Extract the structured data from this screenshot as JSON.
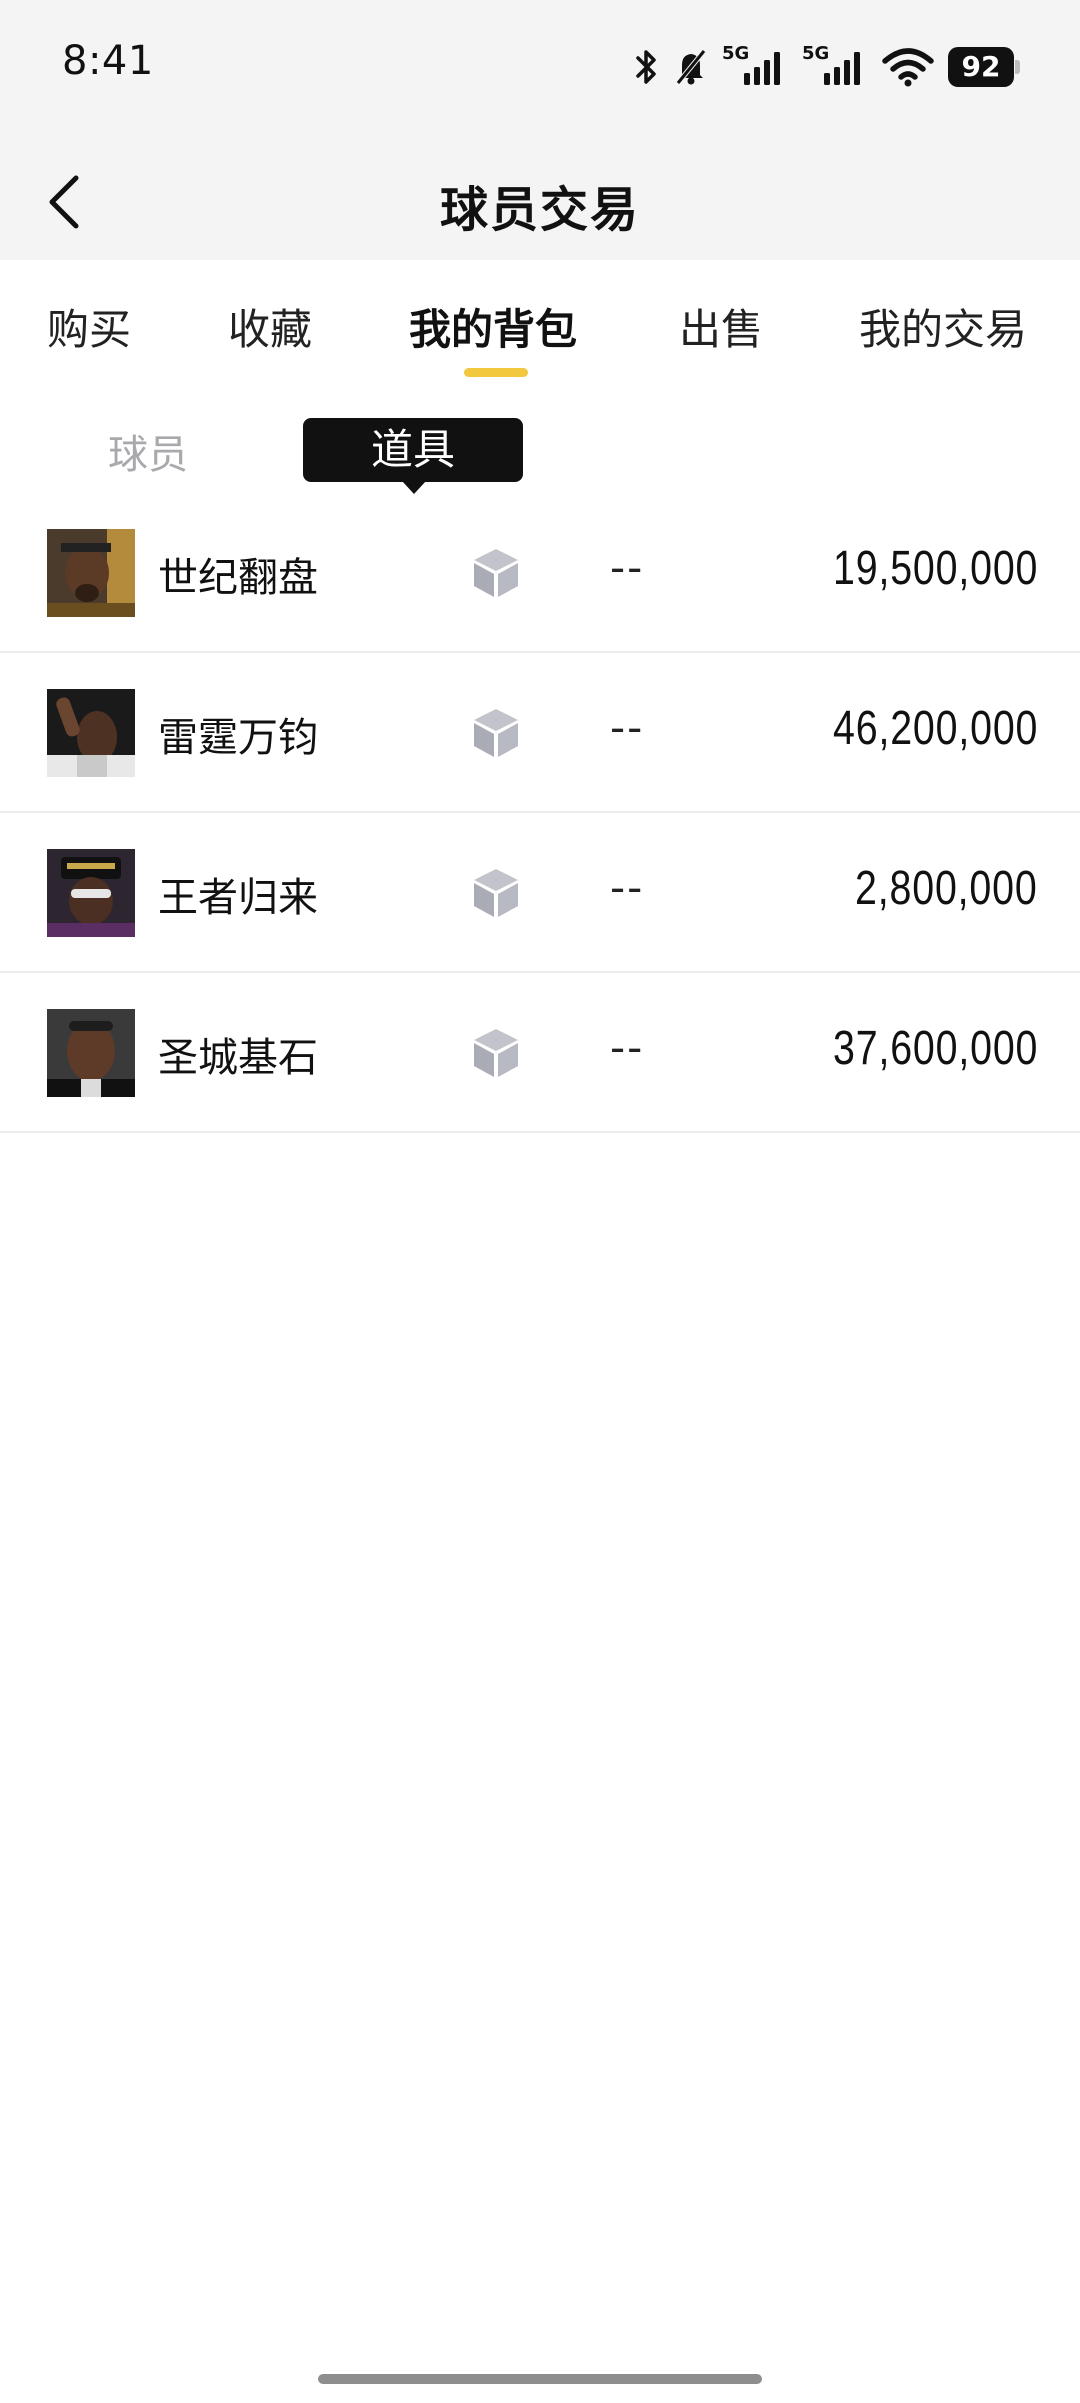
{
  "status_bar": {
    "time": "8:41",
    "network_1": "5G",
    "network_2": "5G",
    "battery": "92",
    "icons": [
      "bluetooth-icon",
      "mute-bell-icon",
      "signal-icon",
      "signal-icon",
      "wifi-icon",
      "battery-icon"
    ]
  },
  "header": {
    "title": "球员交易",
    "back_icon": "chevron-left-icon"
  },
  "tabs": [
    {
      "label": "购买",
      "active": false
    },
    {
      "label": "收藏",
      "active": false
    },
    {
      "label": "我的背包",
      "active": true
    },
    {
      "label": "出售",
      "active": false
    },
    {
      "label": "我的交易",
      "active": false
    }
  ],
  "accent_color": "#f2c83f",
  "subtabs": [
    {
      "label": "球员",
      "active": false
    },
    {
      "label": "道具",
      "active": true
    }
  ],
  "items": [
    {
      "name": "世纪翻盘",
      "icon": "cube-icon",
      "status": "--",
      "value": "19,500,000"
    },
    {
      "name": "雷霆万钧",
      "icon": "cube-icon",
      "status": "--",
      "value": "46,200,000"
    },
    {
      "name": "王者归来",
      "icon": "cube-icon",
      "status": "--",
      "value": "2,800,000"
    },
    {
      "name": "圣城基石",
      "icon": "cube-icon",
      "status": "--",
      "value": "37,600,000"
    }
  ]
}
